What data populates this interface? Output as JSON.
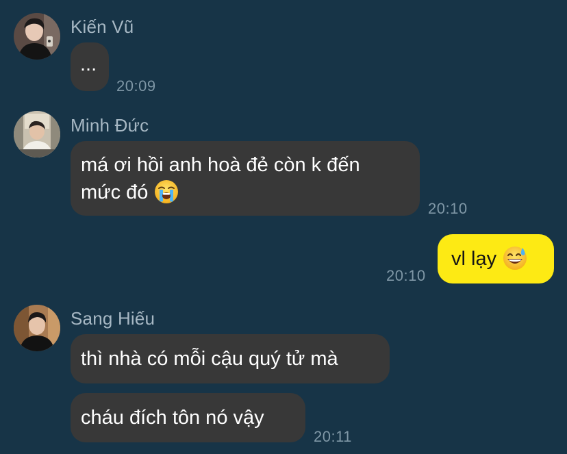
{
  "conversation": {
    "messages": [
      {
        "sender": "Kiến Vũ",
        "avatar": "avatar-kien-vu",
        "lines": [
          "..."
        ],
        "time": "20:09"
      },
      {
        "sender": "Minh Đức",
        "avatar": "avatar-minh-duc",
        "lines": [
          "má ơi hồi anh hoà đẻ còn k đến",
          "mức đó"
        ],
        "emoji": "loudly-crying-face-icon",
        "time": "20:10"
      },
      {
        "sender": "",
        "mine": true,
        "lines": [
          "vl lạy"
        ],
        "emoji": "grinning-face-with-sweat-icon",
        "time": "20:10"
      },
      {
        "sender": "Sang Hiếu",
        "avatar": "avatar-sang-hieu",
        "lines": [
          "thì nhà có mỗi cậu quý tử mà"
        ]
      },
      {
        "sender": "Sang Hiếu",
        "continuation": true,
        "lines": [
          "cháu đích tôn nó vậy"
        ],
        "time": "20:11"
      }
    ]
  },
  "colors": {
    "background": "#173447",
    "incoming_bubble": "#383838",
    "outgoing_bubble": "#fdea14",
    "sender_name": "#a7b8c4",
    "timestamp": "#7f97a6"
  }
}
